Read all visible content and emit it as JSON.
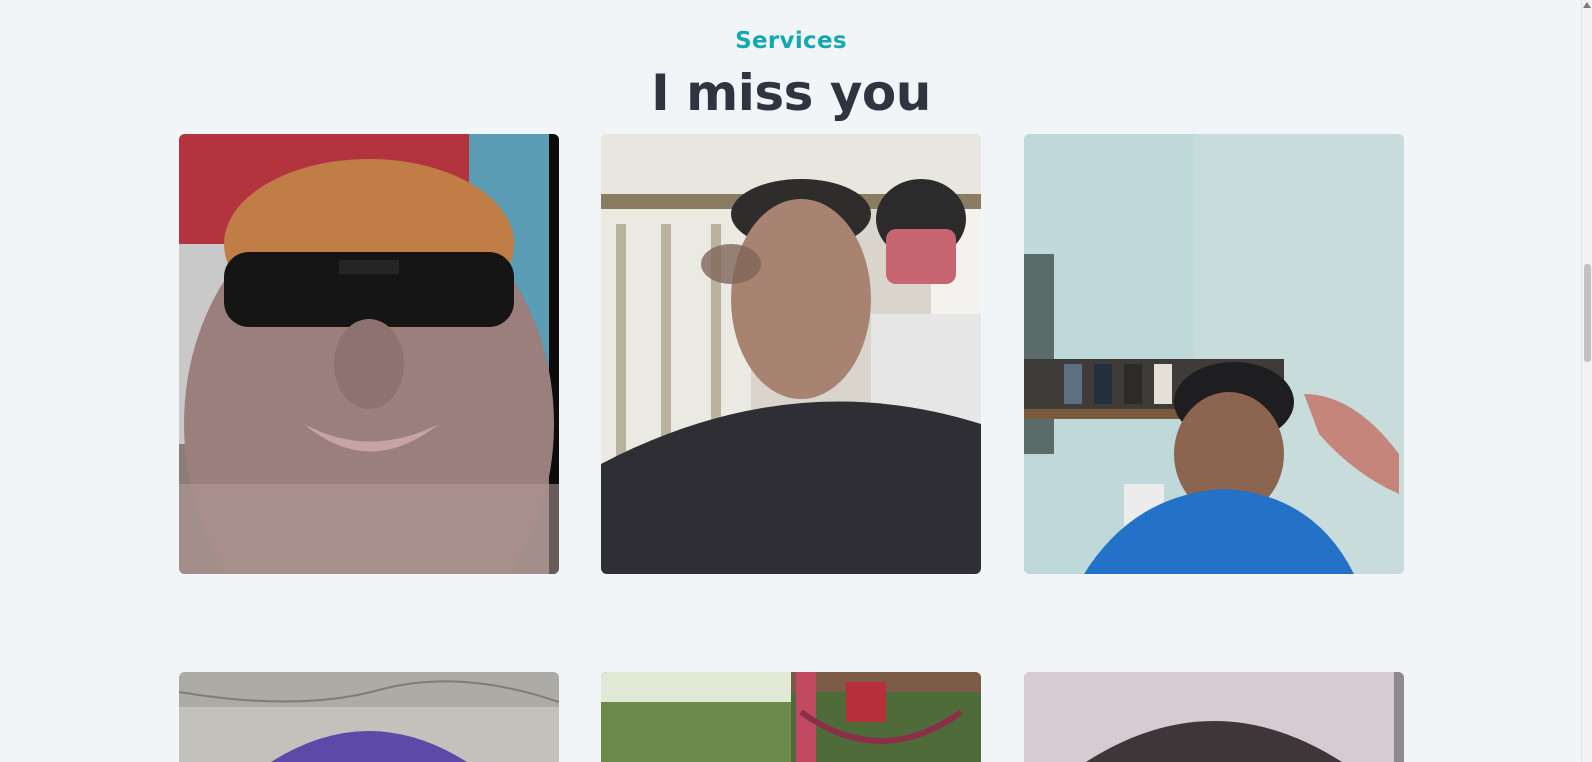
{
  "section": {
    "eyebrow": "Services",
    "headline": "I miss you"
  },
  "gallery": {
    "items": [
      {
        "name": "photo-man-sunglasses"
      },
      {
        "name": "photo-haircut-barbershop-cape"
      },
      {
        "name": "photo-haircut-blue-cape"
      },
      {
        "name": "photo-purple-hair"
      },
      {
        "name": "photo-outdoor-hammock"
      },
      {
        "name": "photo-long-dark-hair"
      }
    ]
  },
  "colors": {
    "background": "#f1f5f8",
    "accent": "#16a8b1",
    "heading": "#2f3540"
  }
}
